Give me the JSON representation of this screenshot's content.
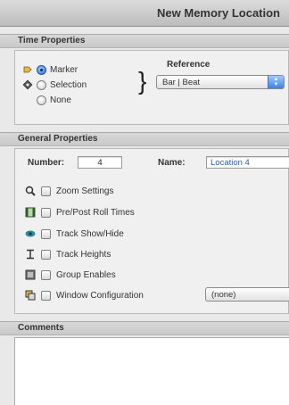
{
  "window": {
    "title": "New Memory Location"
  },
  "time_properties": {
    "header": "Time Properties",
    "options": [
      {
        "label": "Marker",
        "selected": true,
        "icon": "marker-icon"
      },
      {
        "label": "Selection",
        "selected": false,
        "icon": "selection-icon"
      },
      {
        "label": "None",
        "selected": false
      }
    ],
    "reference_label": "Reference",
    "reference_value": "Bar | Beat"
  },
  "general_properties": {
    "header": "General Properties",
    "number_label": "Number:",
    "number_value": "4",
    "name_label": "Name:",
    "name_value": "Location 4",
    "checkboxes": [
      {
        "label": "Zoom Settings",
        "icon": "magnifier-icon",
        "checked": false
      },
      {
        "label": "Pre/Post Roll Times",
        "icon": "pre-post-roll-icon",
        "checked": false
      },
      {
        "label": "Track Show/Hide",
        "icon": "eye-icon",
        "checked": false
      },
      {
        "label": "Track Heights",
        "icon": "track-height-icon",
        "checked": false
      },
      {
        "label": "Group Enables",
        "icon": "group-icon",
        "checked": false
      },
      {
        "label": "Window Configuration",
        "icon": "window-config-icon",
        "checked": false
      }
    ],
    "window_config_value": "(none)"
  },
  "comments": {
    "header": "Comments",
    "value": ""
  },
  "colors": {
    "accent": "#2a6fd6",
    "title_bar": "#c8c8c8",
    "panel": "#f0f0f0"
  }
}
